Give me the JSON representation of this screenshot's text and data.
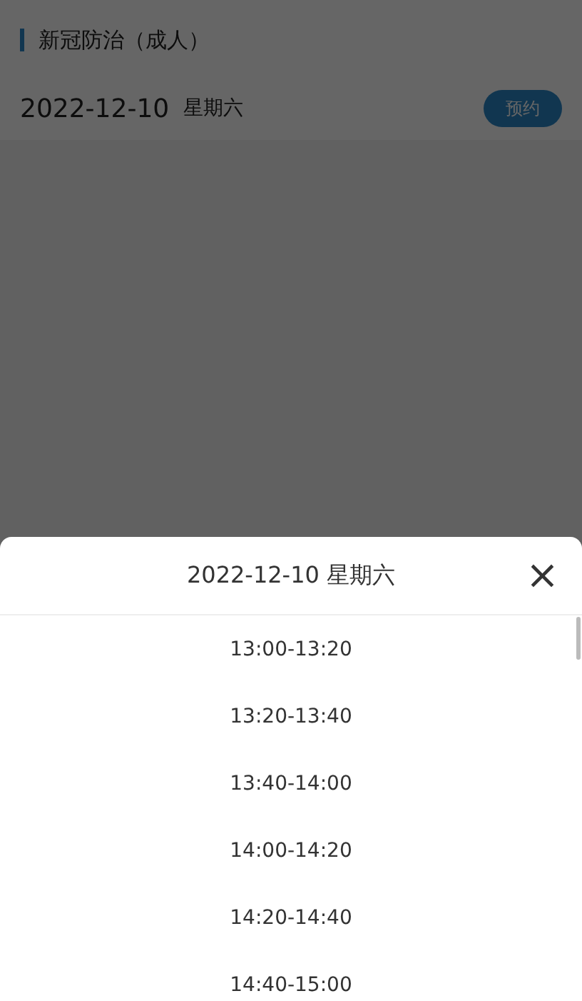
{
  "section": {
    "title": "新冠防治（成人）"
  },
  "date_row": {
    "date": "2022-12-10",
    "weekday": "星期六",
    "button": "预约"
  },
  "sheet": {
    "title": "2022-12-10 星期六",
    "close": "×",
    "slots": [
      "13:00-13:20",
      "13:20-13:40",
      "13:40-14:00",
      "14:00-14:20",
      "14:20-14:40",
      "14:40-15:00"
    ]
  }
}
